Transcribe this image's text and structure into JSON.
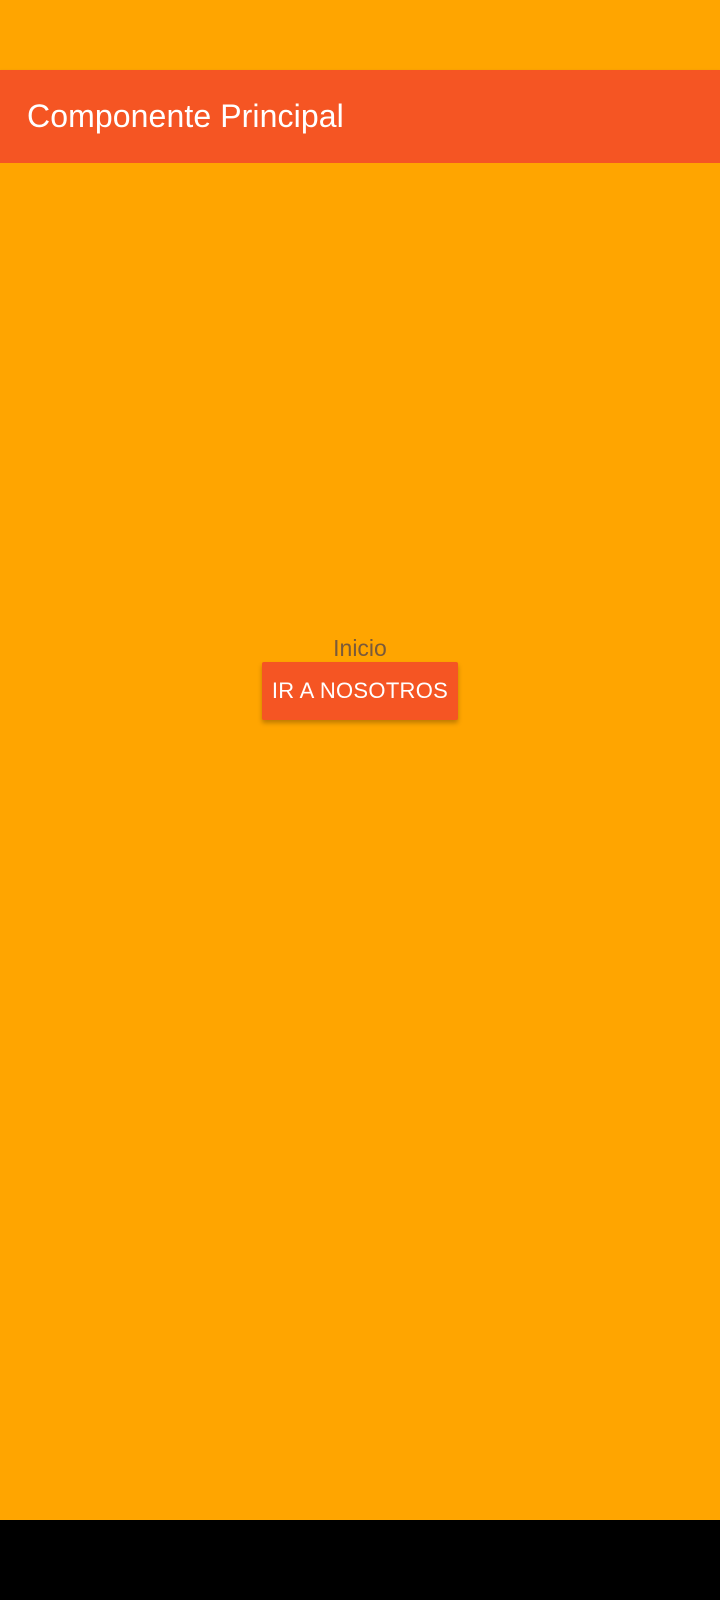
{
  "app_bar": {
    "title": "Componente Principal"
  },
  "main": {
    "screen_label": "Inicio",
    "nav_button_label": "IR A NOSOTROS"
  },
  "colors": {
    "background": "#FFA500",
    "accent": "#F55523",
    "label_text": "#7A5A3A",
    "system_nav": "#000000"
  }
}
